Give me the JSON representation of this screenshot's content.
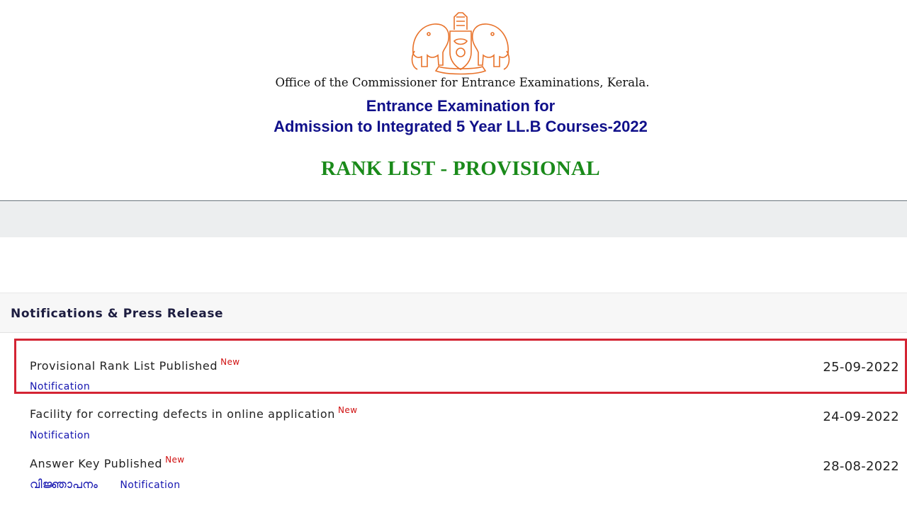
{
  "header": {
    "office": "Office of the Commissioner for Entrance Examinations, Kerala.",
    "exam_line1": "Entrance Examination for",
    "exam_line2": "Admission to Integrated 5 Year LL.B Courses-2022",
    "page_heading": "RANK LIST - PROVISIONAL",
    "emblem_color": "#e8722a"
  },
  "notifications": {
    "title": "Notifications & Press Release",
    "items": [
      {
        "title": "Provisional Rank List Published",
        "badge": "New",
        "date": "25-09-2022",
        "links": [
          "Notification"
        ],
        "highlighted": true
      },
      {
        "title": "Facility for correcting defects in online application",
        "badge": "New",
        "date": "24-09-2022",
        "links": [
          "Notification"
        ],
        "highlighted": false
      },
      {
        "title": "Answer Key Published",
        "badge": "New",
        "date": "28-08-2022",
        "links": [
          "വിജ്ഞാപനം",
          "Notification"
        ],
        "highlighted": false
      }
    ]
  },
  "colors": {
    "accent_blue": "#10108a",
    "heading_green": "#1a8a1a",
    "badge_red": "#d01010",
    "highlight_border": "#d42433"
  }
}
